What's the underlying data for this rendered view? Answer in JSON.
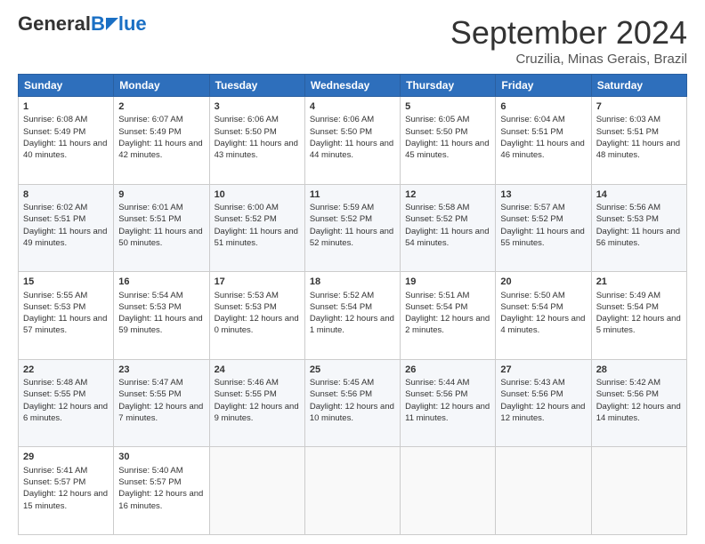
{
  "header": {
    "logo_line1": "General",
    "logo_line2": "Blue",
    "month": "September 2024",
    "location": "Cruzilia, Minas Gerais, Brazil"
  },
  "days_of_week": [
    "Sunday",
    "Monday",
    "Tuesday",
    "Wednesday",
    "Thursday",
    "Friday",
    "Saturday"
  ],
  "weeks": [
    [
      {
        "day": "1",
        "sunrise": "6:08 AM",
        "sunset": "5:49 PM",
        "daylight": "11 hours and 40 minutes."
      },
      {
        "day": "2",
        "sunrise": "6:07 AM",
        "sunset": "5:49 PM",
        "daylight": "11 hours and 42 minutes."
      },
      {
        "day": "3",
        "sunrise": "6:06 AM",
        "sunset": "5:50 PM",
        "daylight": "11 hours and 43 minutes."
      },
      {
        "day": "4",
        "sunrise": "6:06 AM",
        "sunset": "5:50 PM",
        "daylight": "11 hours and 44 minutes."
      },
      {
        "day": "5",
        "sunrise": "6:05 AM",
        "sunset": "5:50 PM",
        "daylight": "11 hours and 45 minutes."
      },
      {
        "day": "6",
        "sunrise": "6:04 AM",
        "sunset": "5:51 PM",
        "daylight": "11 hours and 46 minutes."
      },
      {
        "day": "7",
        "sunrise": "6:03 AM",
        "sunset": "5:51 PM",
        "daylight": "11 hours and 48 minutes."
      }
    ],
    [
      {
        "day": "8",
        "sunrise": "6:02 AM",
        "sunset": "5:51 PM",
        "daylight": "11 hours and 49 minutes."
      },
      {
        "day": "9",
        "sunrise": "6:01 AM",
        "sunset": "5:51 PM",
        "daylight": "11 hours and 50 minutes."
      },
      {
        "day": "10",
        "sunrise": "6:00 AM",
        "sunset": "5:52 PM",
        "daylight": "11 hours and 51 minutes."
      },
      {
        "day": "11",
        "sunrise": "5:59 AM",
        "sunset": "5:52 PM",
        "daylight": "11 hours and 52 minutes."
      },
      {
        "day": "12",
        "sunrise": "5:58 AM",
        "sunset": "5:52 PM",
        "daylight": "11 hours and 54 minutes."
      },
      {
        "day": "13",
        "sunrise": "5:57 AM",
        "sunset": "5:52 PM",
        "daylight": "11 hours and 55 minutes."
      },
      {
        "day": "14",
        "sunrise": "5:56 AM",
        "sunset": "5:53 PM",
        "daylight": "11 hours and 56 minutes."
      }
    ],
    [
      {
        "day": "15",
        "sunrise": "5:55 AM",
        "sunset": "5:53 PM",
        "daylight": "11 hours and 57 minutes."
      },
      {
        "day": "16",
        "sunrise": "5:54 AM",
        "sunset": "5:53 PM",
        "daylight": "11 hours and 59 minutes."
      },
      {
        "day": "17",
        "sunrise": "5:53 AM",
        "sunset": "5:53 PM",
        "daylight": "12 hours and 0 minutes."
      },
      {
        "day": "18",
        "sunrise": "5:52 AM",
        "sunset": "5:54 PM",
        "daylight": "12 hours and 1 minute."
      },
      {
        "day": "19",
        "sunrise": "5:51 AM",
        "sunset": "5:54 PM",
        "daylight": "12 hours and 2 minutes."
      },
      {
        "day": "20",
        "sunrise": "5:50 AM",
        "sunset": "5:54 PM",
        "daylight": "12 hours and 4 minutes."
      },
      {
        "day": "21",
        "sunrise": "5:49 AM",
        "sunset": "5:54 PM",
        "daylight": "12 hours and 5 minutes."
      }
    ],
    [
      {
        "day": "22",
        "sunrise": "5:48 AM",
        "sunset": "5:55 PM",
        "daylight": "12 hours and 6 minutes."
      },
      {
        "day": "23",
        "sunrise": "5:47 AM",
        "sunset": "5:55 PM",
        "daylight": "12 hours and 7 minutes."
      },
      {
        "day": "24",
        "sunrise": "5:46 AM",
        "sunset": "5:55 PM",
        "daylight": "12 hours and 9 minutes."
      },
      {
        "day": "25",
        "sunrise": "5:45 AM",
        "sunset": "5:56 PM",
        "daylight": "12 hours and 10 minutes."
      },
      {
        "day": "26",
        "sunrise": "5:44 AM",
        "sunset": "5:56 PM",
        "daylight": "12 hours and 11 minutes."
      },
      {
        "day": "27",
        "sunrise": "5:43 AM",
        "sunset": "5:56 PM",
        "daylight": "12 hours and 12 minutes."
      },
      {
        "day": "28",
        "sunrise": "5:42 AM",
        "sunset": "5:56 PM",
        "daylight": "12 hours and 14 minutes."
      }
    ],
    [
      {
        "day": "29",
        "sunrise": "5:41 AM",
        "sunset": "5:57 PM",
        "daylight": "12 hours and 15 minutes."
      },
      {
        "day": "30",
        "sunrise": "5:40 AM",
        "sunset": "5:57 PM",
        "daylight": "12 hours and 16 minutes."
      },
      {
        "day": "",
        "sunrise": "",
        "sunset": "",
        "daylight": ""
      },
      {
        "day": "",
        "sunrise": "",
        "sunset": "",
        "daylight": ""
      },
      {
        "day": "",
        "sunrise": "",
        "sunset": "",
        "daylight": ""
      },
      {
        "day": "",
        "sunrise": "",
        "sunset": "",
        "daylight": ""
      },
      {
        "day": "",
        "sunrise": "",
        "sunset": "",
        "daylight": ""
      }
    ]
  ]
}
